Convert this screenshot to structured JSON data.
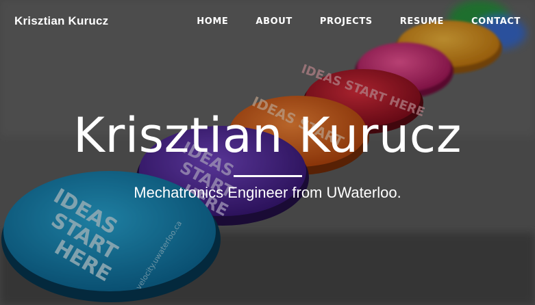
{
  "brand": "Krisztian Kurucz",
  "nav": {
    "home": "HOME",
    "about": "ABOUT",
    "projects": "PROJECTS",
    "resume": "RESUME",
    "contact": "CONTACT"
  },
  "hero": {
    "title": "Krisztian Kurucz",
    "subtitle": "Mechatronics Engineer from UWaterloo."
  },
  "badges": {
    "text": "IDEAS START HERE",
    "url": "velocity.uwaterloo.ca"
  },
  "colors": {
    "text": "#ffffff",
    "badge_teal": "#1a8fc0",
    "badge_purple": "#5b2ca8",
    "badge_orange": "#e0651a",
    "badge_red": "#c2182a",
    "badge_pink": "#e0307a",
    "badge_yellow": "#e8a020"
  }
}
